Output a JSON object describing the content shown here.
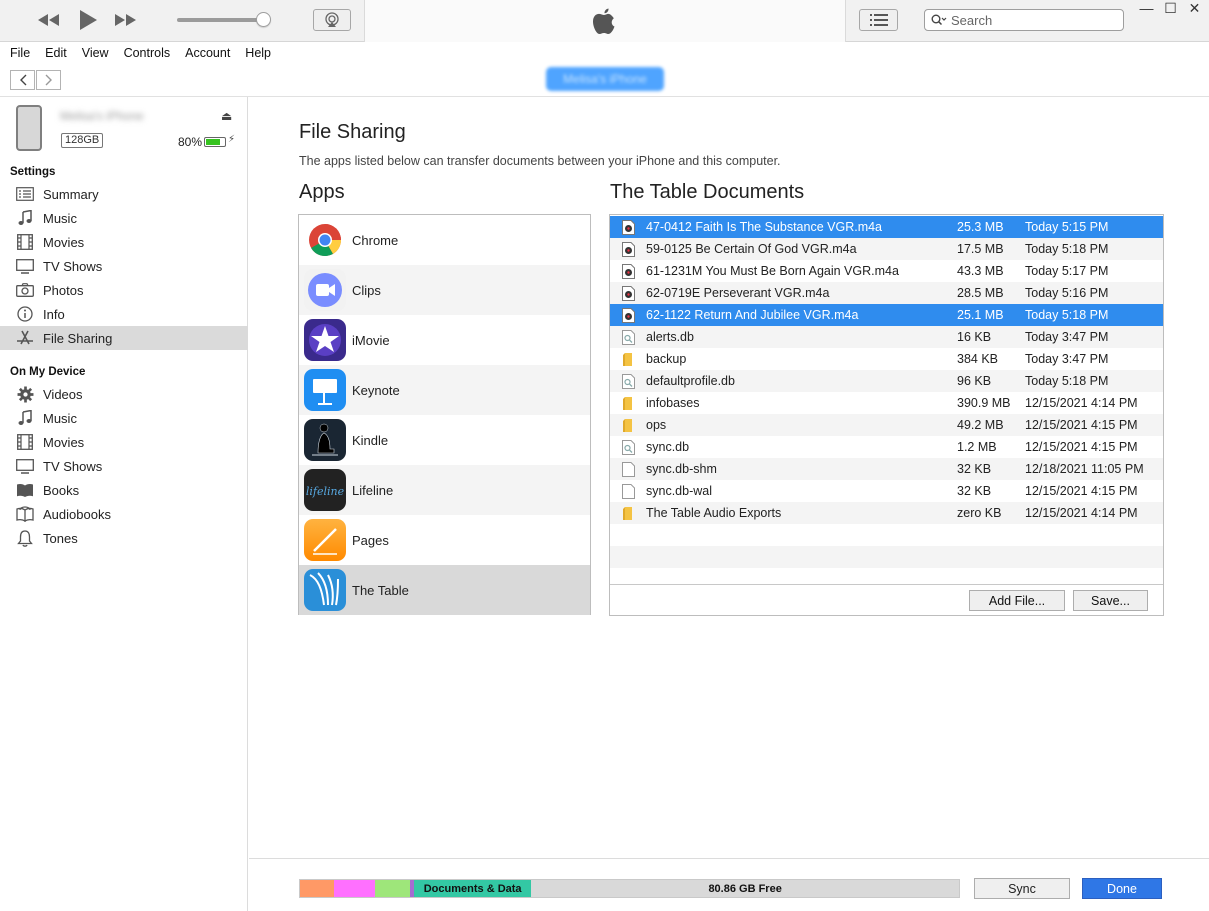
{
  "window": {
    "search_placeholder": "Search",
    "min_glyph": "—",
    "max_glyph": "☐",
    "close_glyph": "✕"
  },
  "menu": [
    "File",
    "Edit",
    "View",
    "Controls",
    "Account",
    "Help"
  ],
  "device": {
    "name": "Melisa's iPhone",
    "capacity": "128GB",
    "battery_pct": "80%",
    "battery_level": 0.8
  },
  "sidebar": {
    "settings_header": "Settings",
    "settings_items": [
      {
        "label": "Summary",
        "icon": "summary-icon"
      },
      {
        "label": "Music",
        "icon": "music-icon"
      },
      {
        "label": "Movies",
        "icon": "movies-icon"
      },
      {
        "label": "TV Shows",
        "icon": "tv-icon"
      },
      {
        "label": "Photos",
        "icon": "camera-icon"
      },
      {
        "label": "Info",
        "icon": "info-icon"
      },
      {
        "label": "File Sharing",
        "icon": "app-store-icon"
      }
    ],
    "device_header": "On My Device",
    "device_items": [
      {
        "label": "Videos",
        "icon": "gear-icon"
      },
      {
        "label": "Music",
        "icon": "music-icon"
      },
      {
        "label": "Movies",
        "icon": "movies-icon"
      },
      {
        "label": "TV Shows",
        "icon": "tv-icon"
      },
      {
        "label": "Books",
        "icon": "books-icon"
      },
      {
        "label": "Audiobooks",
        "icon": "audiobooks-icon"
      },
      {
        "label": "Tones",
        "icon": "bell-icon"
      }
    ]
  },
  "main": {
    "title": "File Sharing",
    "subtitle": "The apps listed below can transfer documents between your iPhone and this computer.",
    "apps_header": "Apps",
    "docs_header": "The Table Documents",
    "apps": [
      {
        "name": "Chrome"
      },
      {
        "name": "Clips"
      },
      {
        "name": "iMovie"
      },
      {
        "name": "Keynote"
      },
      {
        "name": "Kindle"
      },
      {
        "name": "Lifeline"
      },
      {
        "name": "Pages"
      },
      {
        "name": "The Table"
      }
    ],
    "documents": [
      {
        "name": "47-0412 Faith Is The Substance VGR.m4a",
        "size": "25.3 MB",
        "date": "Today 5:15 PM",
        "type": "audio",
        "selected": true
      },
      {
        "name": "59-0125 Be Certain Of God VGR.m4a",
        "size": "17.5 MB",
        "date": "Today 5:18 PM",
        "type": "audio"
      },
      {
        "name": "61-1231M You Must Be Born Again VGR.m4a",
        "size": "43.3 MB",
        "date": "Today 5:17 PM",
        "type": "audio"
      },
      {
        "name": "62-0719E Perseverant VGR.m4a",
        "size": "28.5 MB",
        "date": "Today 5:16 PM",
        "type": "audio"
      },
      {
        "name": "62-1122 Return And Jubilee VGR.m4a",
        "size": "25.1 MB",
        "date": "Today 5:18 PM",
        "type": "audio",
        "selected": true
      },
      {
        "name": "alerts.db",
        "size": "16 KB",
        "date": "Today 3:47 PM",
        "type": "db"
      },
      {
        "name": "backup",
        "size": "384 KB",
        "date": "Today 3:47 PM",
        "type": "folder"
      },
      {
        "name": "defaultprofile.db",
        "size": "96 KB",
        "date": "Today 5:18 PM",
        "type": "db"
      },
      {
        "name": "infobases",
        "size": "390.9 MB",
        "date": "12/15/2021 4:14 PM",
        "type": "folder"
      },
      {
        "name": "ops",
        "size": "49.2 MB",
        "date": "12/15/2021 4:15 PM",
        "type": "folder"
      },
      {
        "name": "sync.db",
        "size": "1.2 MB",
        "date": "12/15/2021 4:15 PM",
        "type": "db"
      },
      {
        "name": "sync.db-shm",
        "size": "32 KB",
        "date": "12/18/2021 11:05 PM",
        "type": "file"
      },
      {
        "name": "sync.db-wal",
        "size": "32 KB",
        "date": "12/15/2021 4:15 PM",
        "type": "file"
      },
      {
        "name": "The Table Audio Exports",
        "size": "zero KB",
        "date": "12/15/2021 4:14 PM",
        "type": "folder"
      }
    ],
    "add_file_label": "Add File...",
    "save_label": "Save..."
  },
  "storage": {
    "segments": [
      {
        "label": "",
        "color": "#ff9966",
        "fraction": 0.051
      },
      {
        "label": "",
        "color": "#ff70ff",
        "fraction": 0.063
      },
      {
        "label": "",
        "color": "#9ee67a",
        "fraction": 0.053
      },
      {
        "label": "",
        "color": "#a46cd1",
        "fraction": 0.006
      },
      {
        "label": "Documents & Data",
        "color": "#33c8a4",
        "fraction": 0.178
      },
      {
        "label": "80.86 GB Free",
        "color": "#d9d9d9",
        "fraction": 0.649
      }
    ]
  },
  "buttons": {
    "sync": "Sync",
    "done": "Done"
  }
}
